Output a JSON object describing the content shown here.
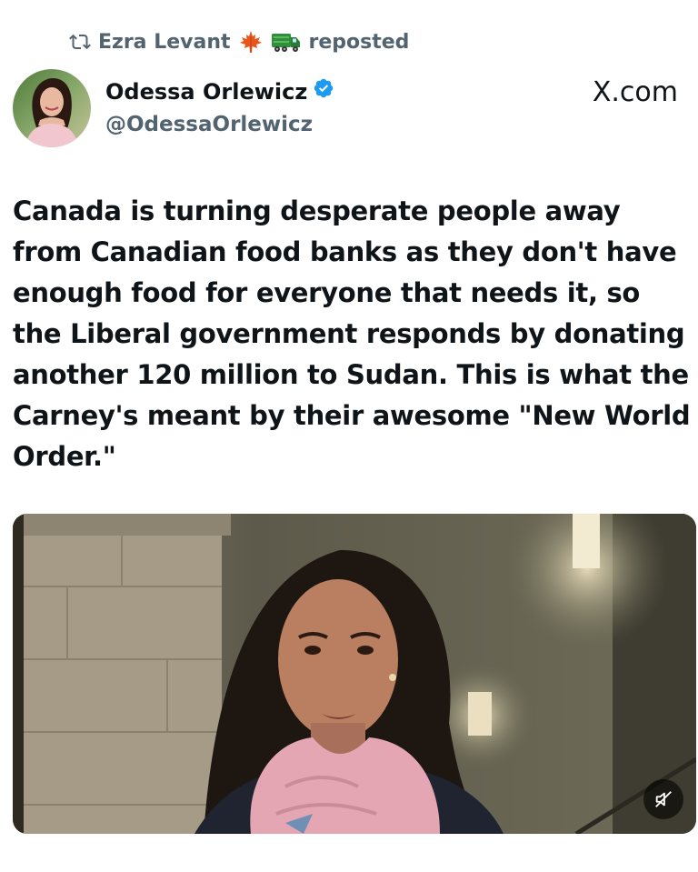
{
  "repost": {
    "name": "Ezra Levant",
    "label": "reposted",
    "emojis": [
      "maple-leaf",
      "truck"
    ]
  },
  "author": {
    "display_name": "Odessa Orlewicz",
    "handle": "@OdessaOrlewicz",
    "verified": true,
    "verified_color": "#1d9bf0"
  },
  "site_label": "X.com",
  "post": {
    "text": "Canada is turning desperate people away from Canadian food banks as they don't have enough food for everyone that needs it, so the Liberal government responds by donating another 120 million to Sudan. This is what the Carney's meant by their awesome \"New World Order.\""
  },
  "media": {
    "type": "video",
    "muted": true,
    "controls": [
      "mute-toggle"
    ]
  },
  "colors": {
    "text": "#0f1419",
    "secondary": "#536471",
    "background": "#ffffff"
  }
}
